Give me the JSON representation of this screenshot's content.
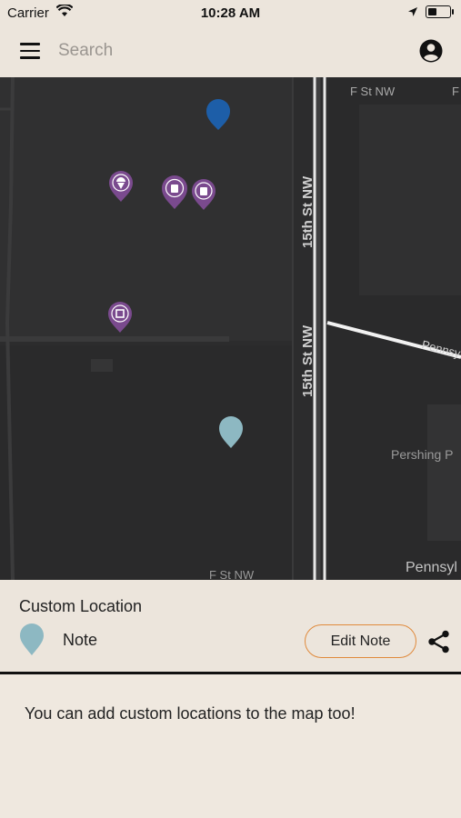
{
  "status_bar": {
    "carrier": "Carrier",
    "time": "10:28 AM"
  },
  "search": {
    "placeholder": "Search"
  },
  "map": {
    "street_labels": [
      "F St NW",
      "F",
      "15th St NW",
      "15th St NW",
      "Pennsy",
      "Pershing P",
      "F St NW",
      "Pennsyl"
    ],
    "markers": [
      {
        "kind": "location",
        "color": "#1d5ea8"
      },
      {
        "kind": "category",
        "color": "#7a4a8e",
        "icon": "ice-cream-icon"
      },
      {
        "kind": "category",
        "color": "#7a4a8e",
        "icon": "food-icon"
      },
      {
        "kind": "category",
        "color": "#7a4a8e",
        "icon": "food-icon"
      },
      {
        "kind": "category",
        "color": "#7a4a8e",
        "icon": "store-icon"
      },
      {
        "kind": "custom",
        "color": "#8db8c2"
      }
    ]
  },
  "detail": {
    "title": "Custom Location",
    "note_label": "Note",
    "edit_button": "Edit Note",
    "accent_color": "#e08a3c"
  },
  "info": {
    "message": "You can add custom locations to the map too!"
  }
}
